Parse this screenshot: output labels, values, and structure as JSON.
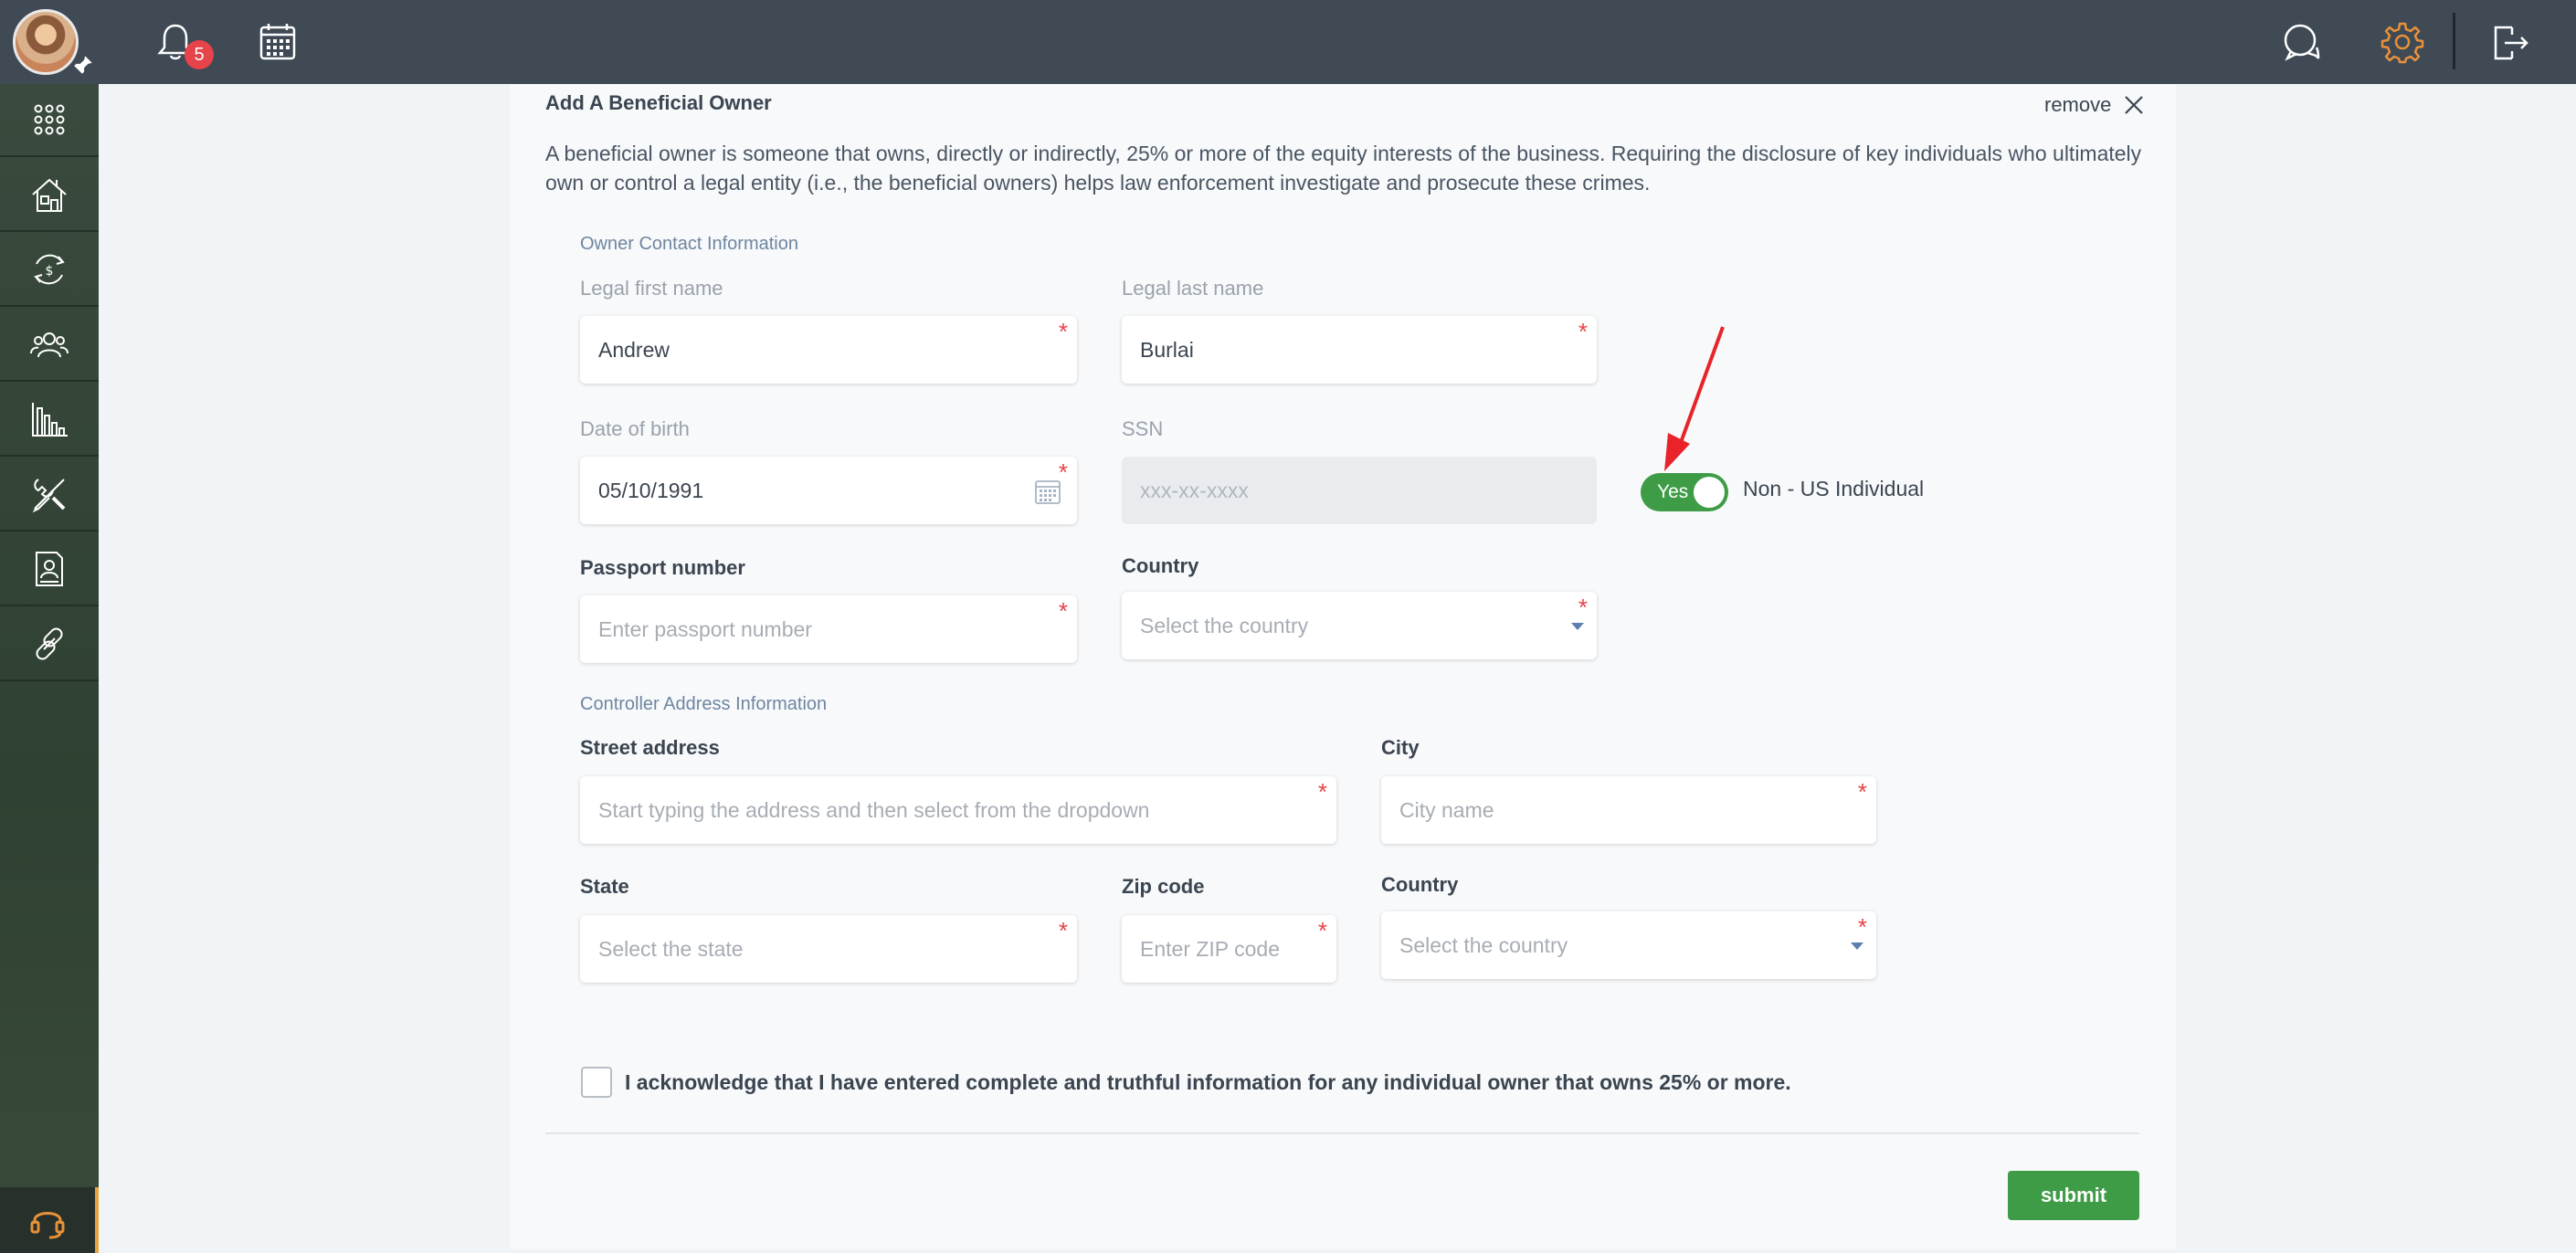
{
  "topbar": {
    "notification_count": "5"
  },
  "form": {
    "title": "Add A Beneficial Owner",
    "remove_label": "remove",
    "description": "A beneficial owner is someone that owns, directly or indirectly, 25% or more of the equity interests of the business. Requiring the disclosure of key individuals who ultimately own or control a legal entity (i.e., the beneficial owners) helps law enforcement investigate and prosecute these crimes.",
    "owner_section": "Owner Contact Information",
    "first_name": {
      "label": "Legal first name",
      "value": "Andrew"
    },
    "last_name": {
      "label": "Legal last name",
      "value": "Burlai"
    },
    "dob": {
      "label": "Date of birth",
      "value": "05/10/1991"
    },
    "ssn": {
      "label": "SSN",
      "placeholder": "xxx-xx-xxxx"
    },
    "non_us_toggle": {
      "state_label": "Yes",
      "text": "Non - US Individual",
      "on": true
    },
    "passport": {
      "label": "Passport number",
      "placeholder": "Enter passport number"
    },
    "country1": {
      "label": "Country",
      "placeholder": "Select the country"
    },
    "address_section": "Controller Address Information",
    "street": {
      "label": "Street address",
      "placeholder": "Start typing the address and then select from the dropdown"
    },
    "city": {
      "label": "City",
      "placeholder": "City name"
    },
    "state": {
      "label": "State",
      "placeholder": "Select the state"
    },
    "zip": {
      "label": "Zip code",
      "placeholder": "Enter ZIP code"
    },
    "country2": {
      "label": "Country",
      "placeholder": "Select the country"
    },
    "acknowledge": "I acknowledge that I have entered complete and truthful information for any individual owner that owns 25% or more.",
    "submit_label": "submit"
  },
  "colors": {
    "accent_green": "#3e9c46",
    "required_red": "#e6434a",
    "topbar": "#3f4a55",
    "settings_orange": "#e8913a"
  },
  "icons": {
    "sidebar": [
      "apps-grid-icon",
      "house-icon",
      "money-exchange-icon",
      "users-icon",
      "bar-chart-icon",
      "tools-icon",
      "contact-document-icon",
      "link-icon"
    ],
    "topbar": [
      "bell-icon",
      "calendar-icon",
      "chat-icon",
      "gear-icon",
      "logout-icon"
    ],
    "support": "headset-icon"
  }
}
